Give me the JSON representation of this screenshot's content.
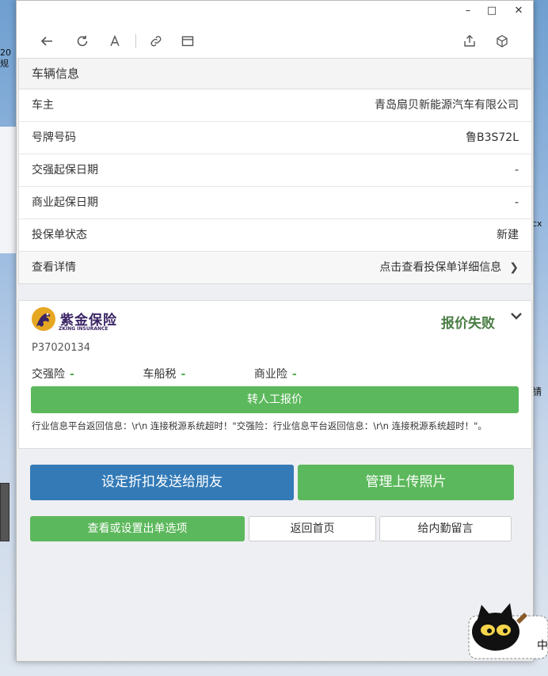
{
  "desktop": {
    "left_text": "20\n规",
    "right_text_1": "cx",
    "right_text_2": "請"
  },
  "vehicle": {
    "section_title": "车辆信息",
    "rows": [
      {
        "label": "车主",
        "value": "青岛扇贝新能源汽车有限公司"
      },
      {
        "label": "号牌号码",
        "value": "鲁B3S72L"
      },
      {
        "label": "交强起保日期",
        "value": "-"
      },
      {
        "label": "商业起保日期",
        "value": "-"
      },
      {
        "label": "投保单状态",
        "value": "新建"
      }
    ],
    "detail_label": "查看详情",
    "detail_value": "点击查看投保单详细信息"
  },
  "quote": {
    "insurer_name": "紫金保险",
    "insurer_sub": "ZKING INSURANCE",
    "status": "报价失败",
    "code": "P37020134",
    "prices": [
      {
        "label": "交强险",
        "value": "-"
      },
      {
        "label": "车船税",
        "value": "-"
      },
      {
        "label": "商业险",
        "value": "-"
      }
    ],
    "manual_button": "转人工报价",
    "message": "行业信息平台返回信息：\\r\\n 连接税源系统超时！\"交强险：行业信息平台返回信息：\\r\\n 连接税源系统超时！\"。"
  },
  "actions": {
    "send_discount": "设定折扣发送给朋友",
    "upload_photos": "管理上传照片",
    "order_options": "查看或设置出单选项",
    "home": "返回首页",
    "internal_message": "给内勤留言"
  },
  "colors": {
    "primary_blue": "#337ab7",
    "success_green": "#5cb85c",
    "status_green": "#4a7d45"
  }
}
